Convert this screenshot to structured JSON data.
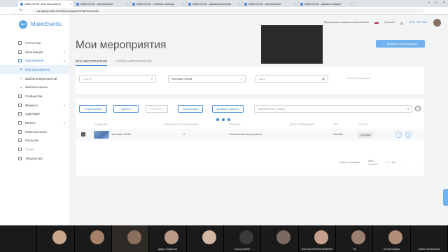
{
  "browser": {
    "tabs": [
      "Make.Events - Мои мероприяти",
      "Make.Events - Мероприятие",
      "Make.Events - Главная страница",
      "Make.Events - Афиша мероприят",
      "Make.Events - Мероприятие",
      "Make.Events - Афиша сообщен"
    ],
    "address": "company.make.events/company/23PAE/events/all"
  },
  "app": {
    "name": "MakeEvents",
    "logo_mark": "ME"
  },
  "sidebar": {
    "items": [
      {
        "label": "Статистика",
        "type": "item"
      },
      {
        "label": "Организация",
        "type": "item",
        "chevron": "▾"
      },
      {
        "label": "Мероприятия",
        "type": "item",
        "chevron": "▴",
        "open": true
      },
      {
        "label": "Мои мероприятия",
        "type": "sub",
        "active": true
      },
      {
        "label": "Шаблоны мероприятий",
        "type": "sub"
      },
      {
        "label": "Шаблоны писем",
        "type": "sub"
      },
      {
        "label": "Сообщества",
        "type": "item"
      },
      {
        "label": "Финансы",
        "type": "item",
        "chevron": "▾"
      },
      {
        "label": "Аудитория",
        "type": "item"
      },
      {
        "label": "Билеты",
        "type": "item",
        "chevron": "▾"
      },
      {
        "label": "Обратная связь",
        "type": "item"
      },
      {
        "label": "Рассылки",
        "type": "item"
      },
      {
        "label": "Промо",
        "type": "item",
        "muted": true
      },
      {
        "label": "Telegram Bot",
        "type": "item"
      }
    ]
  },
  "topbar": {
    "return_link": "Вернуться в старый личный кабинет",
    "language": "Русский",
    "org": "ООО \"ЮПЛАБ\""
  },
  "page": {
    "title": "Мои мероприятия",
    "add_button": "Добавить мероприятие",
    "tabs": [
      "ВСЕ МЕРОПРИЯТИЯ",
      "ПАПКИ МЕРОПРИЯТИЙ"
    ],
    "filters": {
      "status_placeholder": "Статус",
      "search_value": "Тестовое 12345",
      "date_placeholder": "Дата",
      "clear": "Очистить фильтры"
    }
  },
  "table": {
    "actions": [
      "Опубликовать",
      "Удалить",
      "Отменить",
      "Скопировать",
      "Добавить шаблон"
    ],
    "folder_placeholder": "Переместить в папку",
    "headers": [
      "НАЗВАНИЕ",
      "КОЛИЧЕСТВО УЧАСТНИКОВ",
      "РУБРИКА",
      "ДАТА ПРОВЕДЕНИЯ",
      "ТИП",
      "СТАТУС"
    ],
    "rows": [
      {
        "name": "Тестовое 12345",
        "participants": "0",
        "category": "Бесплатные мероприятия",
        "date": "",
        "type": "Онлайн",
        "status": "Черновик"
      }
    ],
    "pager": {
      "label": "Строк на странице:",
      "per_page": "10",
      "range": "1 - 1 из 1"
    }
  },
  "participants": [
    "",
    "",
    "",
    "",
    "Дарья Смирнова",
    "",
    "mtss.proficient",
    "",
    "lives.vidi.2299/936-06489936",
    "Yul",
    "Dmitriy Марков",
    "Сабина Алексеевна"
  ],
  "colors": {
    "accent": "#3b88d4",
    "button": "#6fb2ee"
  }
}
